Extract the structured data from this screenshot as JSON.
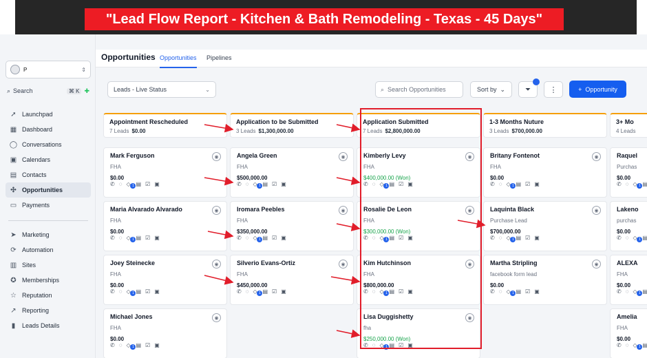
{
  "banner": "\"Lead Flow Report - Kitchen & Bath Remodeling - Texas - 45 Days\"",
  "sidebar": {
    "account_name": "P",
    "search_label": "Search",
    "search_shortcut": "⌘ K",
    "nav_primary": [
      {
        "label": "Launchpad",
        "icon": "rocket-icon"
      },
      {
        "label": "Dashboard",
        "icon": "grid-icon"
      },
      {
        "label": "Conversations",
        "icon": "chat-icon"
      },
      {
        "label": "Calendars",
        "icon": "calendar-icon"
      },
      {
        "label": "Contacts",
        "icon": "contacts-icon"
      },
      {
        "label": "Opportunities",
        "icon": "opportunities-icon",
        "active": true
      },
      {
        "label": "Payments",
        "icon": "payments-icon"
      }
    ],
    "nav_secondary": [
      {
        "label": "Marketing",
        "icon": "send-icon"
      },
      {
        "label": "Automation",
        "icon": "automation-icon"
      },
      {
        "label": "Sites",
        "icon": "sites-icon"
      },
      {
        "label": "Memberships",
        "icon": "memberships-icon"
      },
      {
        "label": "Reputation",
        "icon": "star-icon"
      },
      {
        "label": "Reporting",
        "icon": "reporting-icon"
      },
      {
        "label": "Leads Details",
        "icon": "document-icon"
      }
    ]
  },
  "header": {
    "title": "Opportunities",
    "tabs": [
      {
        "label": "Opportunities",
        "active": true
      },
      {
        "label": "Pipelines"
      }
    ]
  },
  "toolbar": {
    "pipeline_select": "Leads - Live Status",
    "search_placeholder": "Search Opportunities",
    "sort_label": "Sort by",
    "add_label": "Opportunity"
  },
  "colors": {
    "accent": "#155eef",
    "won": "#16a34a",
    "annotation": "#e11d2a"
  },
  "board": [
    {
      "stage": "Appointment Rescheduled",
      "count": "7 Leads",
      "total": "$0.00",
      "cards": [
        {
          "name": "Mark Ferguson",
          "source": "FHA",
          "value": "$0.00"
        },
        {
          "name": "Maria Alvarado Alvarado",
          "source": "FHA",
          "value": "$0.00"
        },
        {
          "name": "Joey Steinecke",
          "source": "FHA",
          "value": "$0.00"
        },
        {
          "name": "Michael Jones",
          "source": "FHA",
          "value": "$0.00"
        }
      ]
    },
    {
      "stage": "Application to be Submitted",
      "count": "3 Leads",
      "total": "$1,300,000.00",
      "cards": [
        {
          "name": "Angela Green",
          "source": "FHA",
          "value": "$500,000.00"
        },
        {
          "name": "Iromara Peebles",
          "source": "FHA",
          "value": "$350,000.00"
        },
        {
          "name": "Silverio Evans-Ortiz",
          "source": "FHA",
          "value": "$450,000.00"
        }
      ]
    },
    {
      "stage": "Application Submitted",
      "count": "7 Leads",
      "total": "$2,800,000.00",
      "cards": [
        {
          "name": "Kimberly Levy",
          "source": "FHA",
          "value": "$400,000.00 (Won)",
          "won": true
        },
        {
          "name": "Rosalie De Leon",
          "source": "FHA",
          "value": "$300,000.00 (Won)",
          "won": true
        },
        {
          "name": "Kim Hutchinson",
          "source": "FHA",
          "value": "$800,000.00"
        },
        {
          "name": "Lisa Duggishetty",
          "source": "fha",
          "value": "$250,000.00 (Won)",
          "won": true
        }
      ]
    },
    {
      "stage": "1-3 Months Nuture",
      "count": "3 Leads",
      "total": "$700,000.00",
      "cards": [
        {
          "name": "Britany Fontenot",
          "source": "FHA",
          "value": "$0.00"
        },
        {
          "name": "Laquinta Black",
          "source": "Purchase Lead",
          "value": "$700,000.00"
        },
        {
          "name": "Martha Stripling",
          "source": "facebook form lead",
          "value": "$0.00"
        }
      ]
    },
    {
      "stage": "3+ Mo",
      "count": "4 Leads",
      "total": "",
      "cards": [
        {
          "name": "Raquel",
          "source": "Purchas",
          "value": "$0.00"
        },
        {
          "name": "Lakeno",
          "source": "purchas",
          "value": "$0.00"
        },
        {
          "name": "ALEXA",
          "source": "FHA",
          "value": "$0.00"
        },
        {
          "name": "Amelia",
          "source": "FHA",
          "value": "$0.00"
        }
      ]
    }
  ],
  "card_icon_badge": "1"
}
